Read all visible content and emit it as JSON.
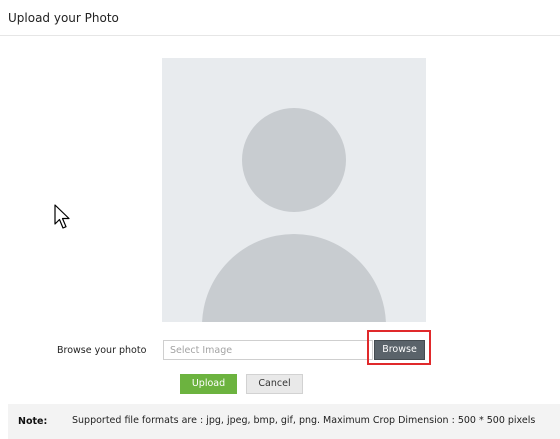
{
  "header": {
    "title": "Upload your Photo"
  },
  "photo": {
    "placeholder_icon": "avatar-silhouette-icon"
  },
  "browse": {
    "label": "Browse your photo",
    "input_placeholder": "Select Image",
    "input_value": "",
    "button_label": "Browse"
  },
  "actions": {
    "upload_label": "Upload",
    "cancel_label": "Cancel"
  },
  "note": {
    "label": "Note:",
    "text": "Supported file formats are : jpg, jpeg, bmp, gif, png. Maximum Crop Dimension : 500 * 500 pixels"
  },
  "colors": {
    "upload_button": "#6cb33f",
    "browse_button": "#5a636a",
    "highlight_border": "#e0292b",
    "photo_background": "#e8ebee",
    "avatar_silhouette": "#c8ccd0"
  }
}
